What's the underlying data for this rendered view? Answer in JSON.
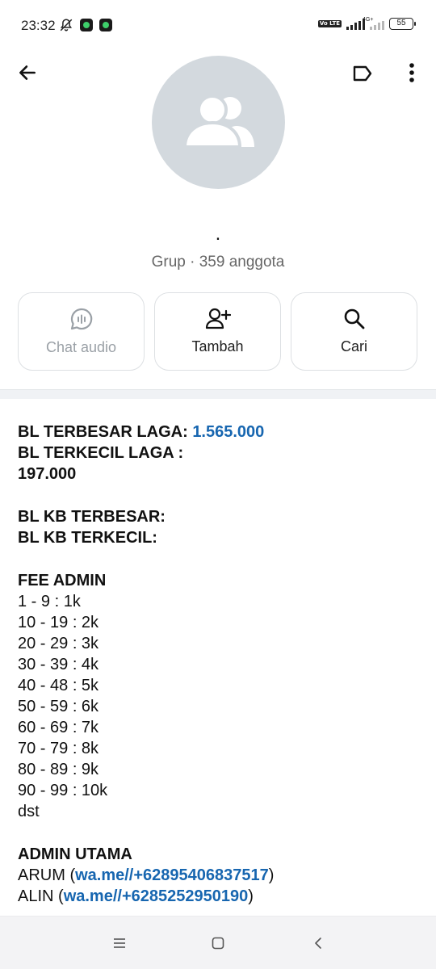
{
  "status": {
    "time": "23:32",
    "network": "4G+",
    "volte": "Vo LTE",
    "battery": "55"
  },
  "group": {
    "name": ".",
    "meta": "Grup · 359 anggota"
  },
  "actions": [
    {
      "label": "Chat audio",
      "icon": "audio-chat-icon",
      "enabled": false
    },
    {
      "label": "Tambah",
      "icon": "add-person-icon",
      "enabled": true
    },
    {
      "label": "Cari",
      "icon": "search-icon",
      "enabled": true
    }
  ],
  "description": {
    "bl_terbesar_label": "BL TERBESAR LAGA: ",
    "bl_terbesar_value": "1.565.000",
    "bl_terkecil_label": "BL TERKECIL LAGA :",
    "bl_terkecil_value": "197.000",
    "kb_terbesar": "BL KB TERBESAR:",
    "kb_terkecil": "BL KB TERKECIL:",
    "fee_title": "FEE ADMIN",
    "fee_rows": [
      "1 - 9 : 1k",
      "10 - 19 : 2k",
      "20 - 29 : 3k",
      "30 - 39 : 4k",
      "40 - 48 : 5k",
      "50 - 59 : 6k",
      "60 - 69 : 7k",
      "70 - 79 : 8k",
      "80 - 89 : 9k",
      "90 - 99 : 10k",
      "dst"
    ],
    "admin_title": "ADMIN UTAMA",
    "admins": [
      {
        "name": "ARUM",
        "link": "wa.me//+62895406837517"
      },
      {
        "name": "ALIN",
        "link": "wa.me//+6285252950190"
      }
    ]
  },
  "colors": {
    "link": "#1766b0",
    "avatar_bg": "#d3d9de"
  }
}
